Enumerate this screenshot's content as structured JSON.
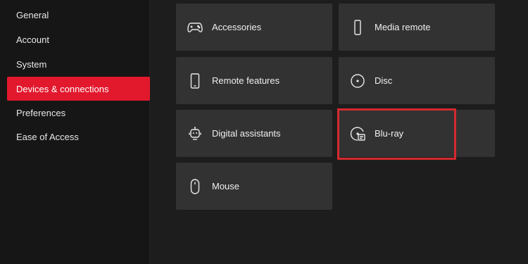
{
  "sidebar": {
    "items": [
      {
        "label": "General",
        "selected": false
      },
      {
        "label": "Account",
        "selected": false
      },
      {
        "label": "System",
        "selected": false
      },
      {
        "label": "Devices & connections",
        "selected": true
      },
      {
        "label": "Preferences",
        "selected": false
      },
      {
        "label": "Ease of Access",
        "selected": false
      }
    ]
  },
  "tiles": [
    {
      "label": "Accessories",
      "icon": "gamepad-icon"
    },
    {
      "label": "Media remote",
      "icon": "remote-icon"
    },
    {
      "label": "Remote features",
      "icon": "phone-icon"
    },
    {
      "label": "Disc",
      "icon": "disc-icon"
    },
    {
      "label": "Digital assistants",
      "icon": "assistant-icon"
    },
    {
      "label": "Blu-ray",
      "icon": "bluray-icon"
    },
    {
      "label": "Mouse",
      "icon": "mouse-icon"
    }
  ],
  "colors": {
    "accent": "#e2182d",
    "highlight_box": "#d4292f",
    "tile_bg": "#323232",
    "background": "#1d1d1d"
  }
}
